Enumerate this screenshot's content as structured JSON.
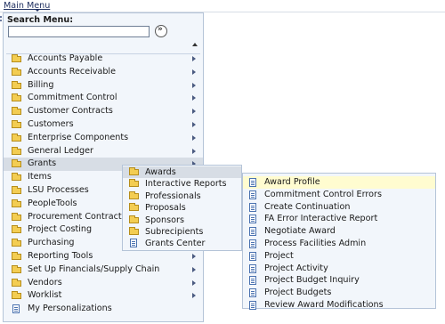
{
  "header": {
    "main_menu_label": "Main Menu"
  },
  "menu": {
    "search_label": "Search Menu:",
    "search_value": "",
    "go_icon": "go-arrows-icon",
    "items": [
      {
        "label": "Accounts Payable",
        "icon": "folder-icon",
        "has_submenu": true
      },
      {
        "label": "Accounts Receivable",
        "icon": "folder-icon",
        "has_submenu": true
      },
      {
        "label": "Billing",
        "icon": "folder-icon",
        "has_submenu": true
      },
      {
        "label": "Commitment Control",
        "icon": "folder-icon",
        "has_submenu": true
      },
      {
        "label": "Customer Contracts",
        "icon": "folder-icon",
        "has_submenu": true
      },
      {
        "label": "Customers",
        "icon": "folder-icon",
        "has_submenu": true
      },
      {
        "label": "Enterprise Components",
        "icon": "folder-icon",
        "has_submenu": true
      },
      {
        "label": "General Ledger",
        "icon": "folder-icon",
        "has_submenu": true
      },
      {
        "label": "Grants",
        "icon": "folder-icon",
        "has_submenu": true,
        "selected": true
      },
      {
        "label": "Items",
        "icon": "folder-icon",
        "has_submenu": true
      },
      {
        "label": "LSU Processes",
        "icon": "folder-icon",
        "has_submenu": true
      },
      {
        "label": "PeopleTools",
        "icon": "folder-icon",
        "has_submenu": true
      },
      {
        "label": "Procurement Contracts",
        "icon": "folder-icon",
        "has_submenu": true
      },
      {
        "label": "Project Costing",
        "icon": "folder-icon",
        "has_submenu": true
      },
      {
        "label": "Purchasing",
        "icon": "folder-icon",
        "has_submenu": true
      },
      {
        "label": "Reporting Tools",
        "icon": "folder-icon",
        "has_submenu": true
      },
      {
        "label": "Set Up Financials/Supply Chain",
        "icon": "folder-icon",
        "has_submenu": true
      },
      {
        "label": "Vendors",
        "icon": "folder-icon",
        "has_submenu": true
      },
      {
        "label": "Worklist",
        "icon": "folder-icon",
        "has_submenu": true
      },
      {
        "label": "My Personalizations",
        "icon": "document-icon",
        "has_submenu": false
      }
    ]
  },
  "grants_submenu": {
    "items": [
      {
        "label": "Awards",
        "icon": "folder-icon",
        "selected": true
      },
      {
        "label": "Interactive Reports",
        "icon": "folder-icon"
      },
      {
        "label": "Professionals",
        "icon": "folder-icon"
      },
      {
        "label": "Proposals",
        "icon": "folder-icon"
      },
      {
        "label": "Sponsors",
        "icon": "folder-icon"
      },
      {
        "label": "Subrecipients",
        "icon": "folder-icon"
      },
      {
        "label": "Grants Center",
        "icon": "document-icon"
      }
    ]
  },
  "awards_submenu": {
    "items": [
      {
        "label": "Award Profile",
        "highlight": true
      },
      {
        "label": "Commitment Control Errors"
      },
      {
        "label": "Create Continuation"
      },
      {
        "label": "FA Error Interactive Report"
      },
      {
        "label": "Negotiate Award"
      },
      {
        "label": "Process Facilities Admin"
      },
      {
        "label": "Project"
      },
      {
        "label": "Project Activity"
      },
      {
        "label": "Project Budget Inquiry"
      },
      {
        "label": "Project Budgets"
      },
      {
        "label": "Review Award Modifications"
      }
    ]
  },
  "colors": {
    "menu_bg": "#f2f6fb",
    "selected_bg": "#d7dde5",
    "highlight_bg": "#fffcd0",
    "folder": "#f3cd52"
  }
}
